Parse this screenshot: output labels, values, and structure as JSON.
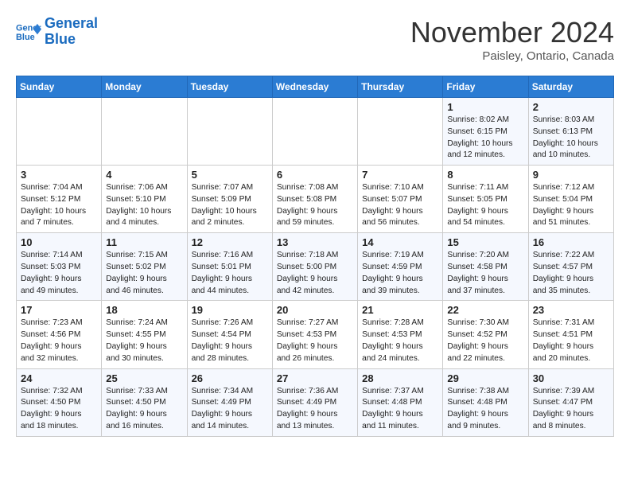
{
  "header": {
    "logo_line1": "General",
    "logo_line2": "Blue",
    "month": "November 2024",
    "location": "Paisley, Ontario, Canada"
  },
  "days_of_week": [
    "Sunday",
    "Monday",
    "Tuesday",
    "Wednesday",
    "Thursday",
    "Friday",
    "Saturday"
  ],
  "weeks": [
    [
      {
        "day": "",
        "info": ""
      },
      {
        "day": "",
        "info": ""
      },
      {
        "day": "",
        "info": ""
      },
      {
        "day": "",
        "info": ""
      },
      {
        "day": "",
        "info": ""
      },
      {
        "day": "1",
        "info": "Sunrise: 8:02 AM\nSunset: 6:15 PM\nDaylight: 10 hours\nand 12 minutes."
      },
      {
        "day": "2",
        "info": "Sunrise: 8:03 AM\nSunset: 6:13 PM\nDaylight: 10 hours\nand 10 minutes."
      }
    ],
    [
      {
        "day": "3",
        "info": "Sunrise: 7:04 AM\nSunset: 5:12 PM\nDaylight: 10 hours\nand 7 minutes."
      },
      {
        "day": "4",
        "info": "Sunrise: 7:06 AM\nSunset: 5:10 PM\nDaylight: 10 hours\nand 4 minutes."
      },
      {
        "day": "5",
        "info": "Sunrise: 7:07 AM\nSunset: 5:09 PM\nDaylight: 10 hours\nand 2 minutes."
      },
      {
        "day": "6",
        "info": "Sunrise: 7:08 AM\nSunset: 5:08 PM\nDaylight: 9 hours\nand 59 minutes."
      },
      {
        "day": "7",
        "info": "Sunrise: 7:10 AM\nSunset: 5:07 PM\nDaylight: 9 hours\nand 56 minutes."
      },
      {
        "day": "8",
        "info": "Sunrise: 7:11 AM\nSunset: 5:05 PM\nDaylight: 9 hours\nand 54 minutes."
      },
      {
        "day": "9",
        "info": "Sunrise: 7:12 AM\nSunset: 5:04 PM\nDaylight: 9 hours\nand 51 minutes."
      }
    ],
    [
      {
        "day": "10",
        "info": "Sunrise: 7:14 AM\nSunset: 5:03 PM\nDaylight: 9 hours\nand 49 minutes."
      },
      {
        "day": "11",
        "info": "Sunrise: 7:15 AM\nSunset: 5:02 PM\nDaylight: 9 hours\nand 46 minutes."
      },
      {
        "day": "12",
        "info": "Sunrise: 7:16 AM\nSunset: 5:01 PM\nDaylight: 9 hours\nand 44 minutes."
      },
      {
        "day": "13",
        "info": "Sunrise: 7:18 AM\nSunset: 5:00 PM\nDaylight: 9 hours\nand 42 minutes."
      },
      {
        "day": "14",
        "info": "Sunrise: 7:19 AM\nSunset: 4:59 PM\nDaylight: 9 hours\nand 39 minutes."
      },
      {
        "day": "15",
        "info": "Sunrise: 7:20 AM\nSunset: 4:58 PM\nDaylight: 9 hours\nand 37 minutes."
      },
      {
        "day": "16",
        "info": "Sunrise: 7:22 AM\nSunset: 4:57 PM\nDaylight: 9 hours\nand 35 minutes."
      }
    ],
    [
      {
        "day": "17",
        "info": "Sunrise: 7:23 AM\nSunset: 4:56 PM\nDaylight: 9 hours\nand 32 minutes."
      },
      {
        "day": "18",
        "info": "Sunrise: 7:24 AM\nSunset: 4:55 PM\nDaylight: 9 hours\nand 30 minutes."
      },
      {
        "day": "19",
        "info": "Sunrise: 7:26 AM\nSunset: 4:54 PM\nDaylight: 9 hours\nand 28 minutes."
      },
      {
        "day": "20",
        "info": "Sunrise: 7:27 AM\nSunset: 4:53 PM\nDaylight: 9 hours\nand 26 minutes."
      },
      {
        "day": "21",
        "info": "Sunrise: 7:28 AM\nSunset: 4:53 PM\nDaylight: 9 hours\nand 24 minutes."
      },
      {
        "day": "22",
        "info": "Sunrise: 7:30 AM\nSunset: 4:52 PM\nDaylight: 9 hours\nand 22 minutes."
      },
      {
        "day": "23",
        "info": "Sunrise: 7:31 AM\nSunset: 4:51 PM\nDaylight: 9 hours\nand 20 minutes."
      }
    ],
    [
      {
        "day": "24",
        "info": "Sunrise: 7:32 AM\nSunset: 4:50 PM\nDaylight: 9 hours\nand 18 minutes."
      },
      {
        "day": "25",
        "info": "Sunrise: 7:33 AM\nSunset: 4:50 PM\nDaylight: 9 hours\nand 16 minutes."
      },
      {
        "day": "26",
        "info": "Sunrise: 7:34 AM\nSunset: 4:49 PM\nDaylight: 9 hours\nand 14 minutes."
      },
      {
        "day": "27",
        "info": "Sunrise: 7:36 AM\nSunset: 4:49 PM\nDaylight: 9 hours\nand 13 minutes."
      },
      {
        "day": "28",
        "info": "Sunrise: 7:37 AM\nSunset: 4:48 PM\nDaylight: 9 hours\nand 11 minutes."
      },
      {
        "day": "29",
        "info": "Sunrise: 7:38 AM\nSunset: 4:48 PM\nDaylight: 9 hours\nand 9 minutes."
      },
      {
        "day": "30",
        "info": "Sunrise: 7:39 AM\nSunset: 4:47 PM\nDaylight: 9 hours\nand 8 minutes."
      }
    ]
  ]
}
